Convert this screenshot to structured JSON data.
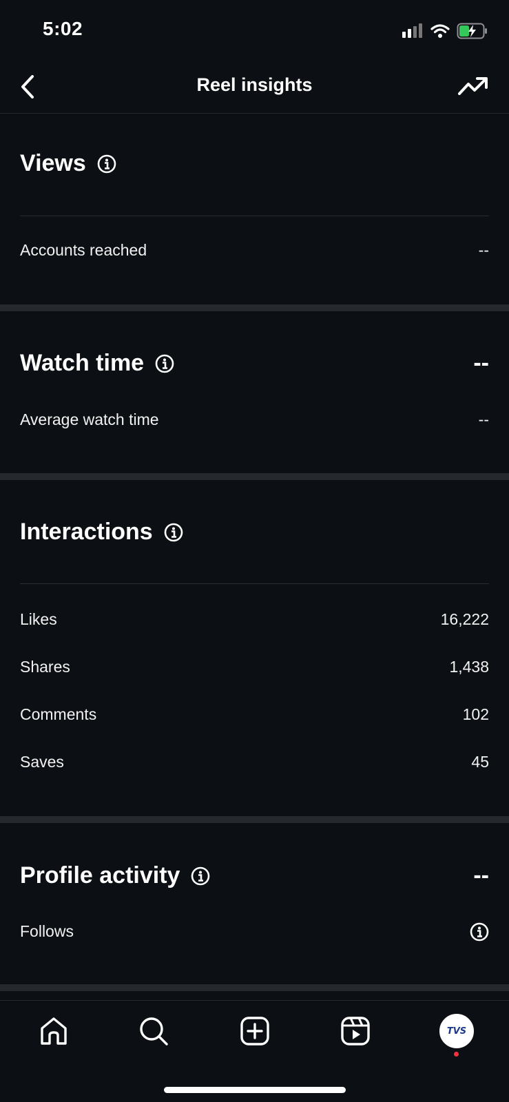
{
  "status_bar": {
    "time": "5:02"
  },
  "header": {
    "title": "Reel insights"
  },
  "views": {
    "title": "Views",
    "accounts_reached_label": "Accounts reached",
    "accounts_reached_value": "--"
  },
  "watch_time": {
    "title": "Watch time",
    "value": "--",
    "avg_label": "Average watch time",
    "avg_value": "--"
  },
  "interactions": {
    "title": "Interactions",
    "rows": [
      {
        "label": "Likes",
        "value": "16,222"
      },
      {
        "label": "Shares",
        "value": "1,438"
      },
      {
        "label": "Comments",
        "value": "102"
      },
      {
        "label": "Saves",
        "value": "45"
      }
    ]
  },
  "profile_activity": {
    "title": "Profile activity",
    "value": "--",
    "follows_label": "Follows"
  },
  "nav": {
    "items": [
      "home-icon",
      "search-icon",
      "create-icon",
      "reels-icon",
      "profile-avatar"
    ],
    "avatar_text": "TVS"
  },
  "colors": {
    "background": "#0c1014",
    "band": "#25292e",
    "text": "#ffffff",
    "notification": "#ff3040",
    "battery": "#34c759"
  }
}
